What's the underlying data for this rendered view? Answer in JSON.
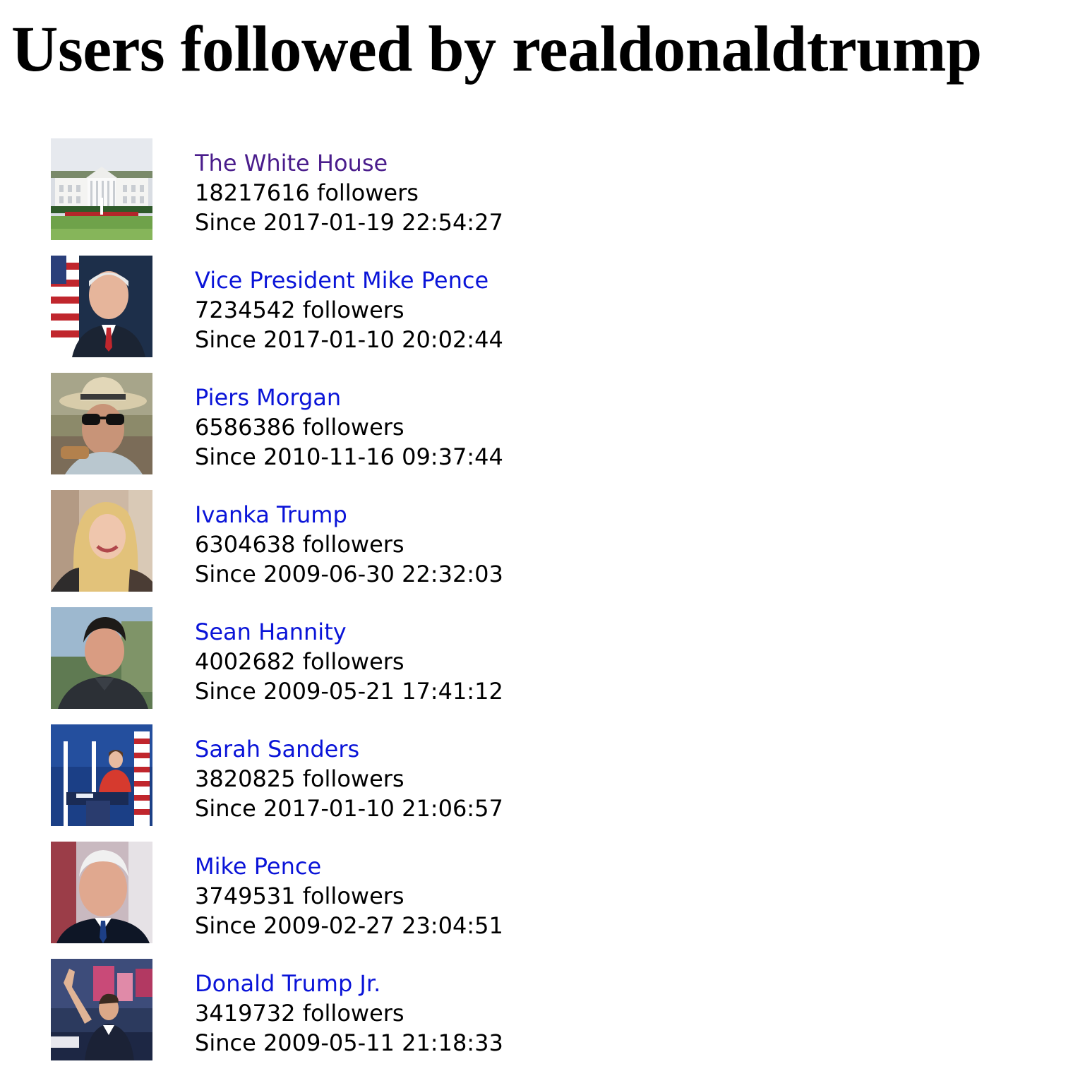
{
  "page": {
    "title": "Users followed by realdonaldtrump"
  },
  "colors": {
    "link": "#0a14d8",
    "visited_link": "#4a1d8c",
    "text": "#000000"
  },
  "users": [
    {
      "name": "The White House",
      "followers": "18217616 followers",
      "since": "Since 2017-01-19 22:54:27",
      "visited": true,
      "avatar": "white-house-avatar"
    },
    {
      "name": "Vice President Mike Pence",
      "followers": "7234542 followers",
      "since": "Since 2017-01-10 20:02:44",
      "visited": false,
      "avatar": "vp-pence-avatar"
    },
    {
      "name": "Piers Morgan",
      "followers": "6586386 followers",
      "since": "Since 2010-11-16 09:37:44",
      "visited": false,
      "avatar": "piers-morgan-avatar"
    },
    {
      "name": "Ivanka Trump",
      "followers": "6304638 followers",
      "since": "Since 2009-06-30 22:32:03",
      "visited": false,
      "avatar": "ivanka-trump-avatar"
    },
    {
      "name": "Sean Hannity",
      "followers": "4002682 followers",
      "since": "Since 2009-05-21 17:41:12",
      "visited": false,
      "avatar": "sean-hannity-avatar"
    },
    {
      "name": "Sarah Sanders",
      "followers": "3820825 followers",
      "since": "Since 2017-01-10 21:06:57",
      "visited": false,
      "avatar": "sarah-sanders-avatar"
    },
    {
      "name": "Mike Pence",
      "followers": "3749531 followers",
      "since": "Since 2009-02-27 23:04:51",
      "visited": false,
      "avatar": "mike-pence-avatar"
    },
    {
      "name": "Donald Trump Jr.",
      "followers": "3419732 followers",
      "since": "Since 2009-05-11 21:18:33",
      "visited": false,
      "avatar": "donald-trump-jr-avatar"
    }
  ]
}
